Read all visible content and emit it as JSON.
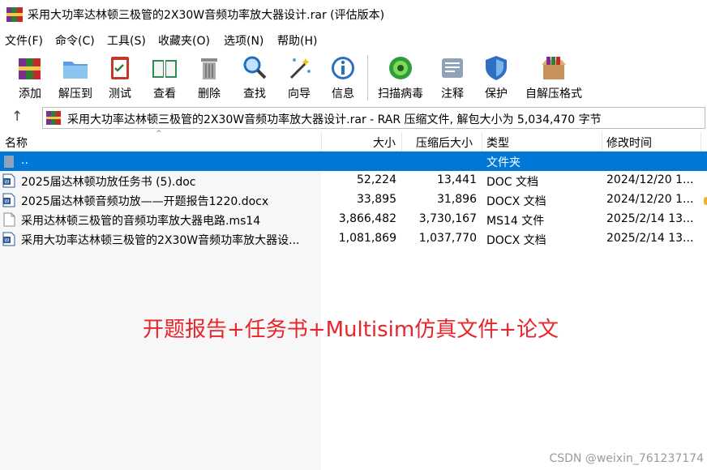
{
  "window": {
    "title": "采用大功率达林顿三极管的2X30W音频功率放大器设计.rar (评估版本)"
  },
  "menu": [
    "文件(F)",
    "命令(C)",
    "工具(S)",
    "收藏夹(O)",
    "选项(N)",
    "帮助(H)"
  ],
  "toolbar": {
    "add": "添加",
    "extract": "解压到",
    "test": "测试",
    "view": "查看",
    "delete": "删除",
    "find": "查找",
    "wizard": "向导",
    "info": "信息",
    "scan": "扫描病毒",
    "comment": "注释",
    "protect": "保护",
    "sfx": "自解压格式"
  },
  "address": {
    "text": "采用大功率达林顿三极管的2X30W音频功率放大器设计.rar - RAR 压缩文件, 解包大小为 5,034,470 字节"
  },
  "columns": {
    "name": "名称",
    "size": "大小",
    "packed": "压缩后大小",
    "type": "类型",
    "modified": "修改时间"
  },
  "rows": [
    {
      "name": "..",
      "size": "",
      "packed": "",
      "type": "文件夹",
      "modified": "",
      "icon": "folder-up-icon"
    },
    {
      "name": "2025届达林顿功放任务书 (5).doc",
      "size": "52,224",
      "packed": "13,441",
      "type": "DOC 文档",
      "modified": "2024/12/20 1...",
      "icon": "word-doc-icon"
    },
    {
      "name": "2025届达林顿音频功放——开题报告1220.docx",
      "size": "33,895",
      "packed": "31,896",
      "type": "DOCX 文档",
      "modified": "2024/12/20 1...",
      "icon": "word-doc-icon"
    },
    {
      "name": "采用达林顿三极管的音频功率放大器电路.ms14",
      "size": "3,866,482",
      "packed": "3,730,167",
      "type": "MS14 文件",
      "modified": "2025/2/14 13...",
      "icon": "blank-file-icon"
    },
    {
      "name": "采用大功率达林顿三极管的2X30W音频功率放大器设...",
      "size": "1,081,869",
      "packed": "1,037,770",
      "type": "DOCX 文档",
      "modified": "2025/2/14 13...",
      "icon": "word-doc-icon"
    }
  ],
  "overlay": {
    "text": "开题报告+任务书+Multisim仿真文件+论文"
  },
  "watermark": {
    "text": "CSDN @weixin_761237174"
  },
  "colors": {
    "selection": "#0078d7",
    "overlay_red": "#e8252a"
  }
}
